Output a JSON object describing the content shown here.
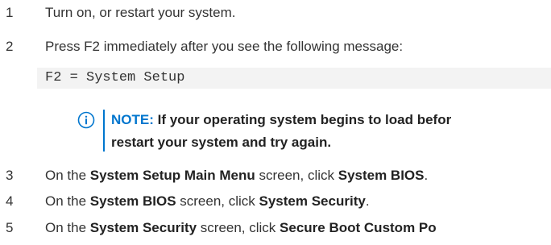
{
  "steps": [
    {
      "num": "1",
      "parts": [
        {
          "t": "Turn on, or restart your system."
        }
      ]
    },
    {
      "num": "2",
      "parts": [
        {
          "t": "Press F2 immediately after you see the following message:"
        }
      ]
    },
    {
      "num": "3",
      "parts": [
        {
          "t": "On the "
        },
        {
          "t": "System Setup Main Menu",
          "b": true
        },
        {
          "t": " screen, click "
        },
        {
          "t": "System BIOS",
          "b": true
        },
        {
          "t": "."
        }
      ]
    },
    {
      "num": "4",
      "parts": [
        {
          "t": "On the "
        },
        {
          "t": "System BIOS",
          "b": true
        },
        {
          "t": " screen, click "
        },
        {
          "t": "System Security",
          "b": true
        },
        {
          "t": "."
        }
      ]
    },
    {
      "num": "5",
      "parts": [
        {
          "t": "On the "
        },
        {
          "t": "System Security",
          "b": true
        },
        {
          "t": " screen, click "
        },
        {
          "t": "Secure Boot Custom Po",
          "b": true
        }
      ]
    }
  ],
  "code_message": "F2 = System Setup",
  "note": {
    "label": "NOTE:",
    "line1": " If your operating system begins to load befor",
    "line2": "restart your system and try again.",
    "icon": "info-circle-icon",
    "accent_color": "#0076ce"
  }
}
